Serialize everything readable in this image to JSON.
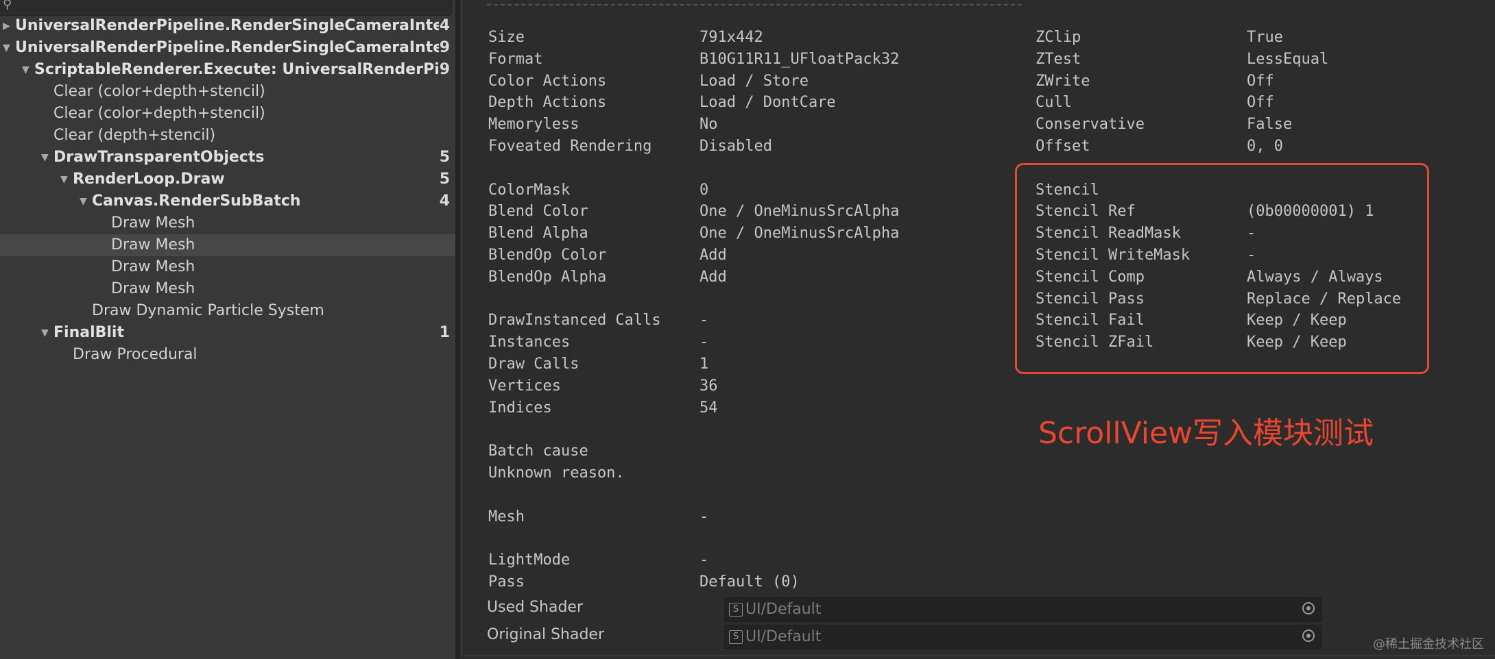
{
  "hierarchy": {
    "rows": [
      {
        "label": "UniversalRenderPipeline.RenderSingleCameraInterna",
        "count": "4",
        "bold": true,
        "arrow": "right",
        "indent": 0
      },
      {
        "label": "UniversalRenderPipeline.RenderSingleCameraInterna",
        "count": "9",
        "bold": true,
        "arrow": "down",
        "indent": 0
      },
      {
        "label": "ScriptableRenderer.Execute: UniversalRenderPipe",
        "count": "9",
        "bold": true,
        "arrow": "down",
        "indent": 1
      },
      {
        "label": "Clear (color+depth+stencil)",
        "count": "",
        "bold": false,
        "arrow": "",
        "indent": 2
      },
      {
        "label": "Clear (color+depth+stencil)",
        "count": "",
        "bold": false,
        "arrow": "",
        "indent": 2
      },
      {
        "label": "Clear (depth+stencil)",
        "count": "",
        "bold": false,
        "arrow": "",
        "indent": 2
      },
      {
        "label": "DrawTransparentObjects",
        "count": "5",
        "bold": true,
        "arrow": "down",
        "indent": 2
      },
      {
        "label": "RenderLoop.Draw",
        "count": "5",
        "bold": true,
        "arrow": "down",
        "indent": 3
      },
      {
        "label": "Canvas.RenderSubBatch",
        "count": "4",
        "bold": true,
        "arrow": "down",
        "indent": 4
      },
      {
        "label": "Draw Mesh",
        "count": "",
        "bold": false,
        "arrow": "",
        "indent": 5
      },
      {
        "label": "Draw Mesh",
        "count": "",
        "bold": false,
        "arrow": "",
        "indent": 5,
        "selected": true
      },
      {
        "label": "Draw Mesh",
        "count": "",
        "bold": false,
        "arrow": "",
        "indent": 5
      },
      {
        "label": "Draw Mesh",
        "count": "",
        "bold": false,
        "arrow": "",
        "indent": 5
      },
      {
        "label": "Draw Dynamic Particle System",
        "count": "",
        "bold": false,
        "arrow": "",
        "indent": 4
      },
      {
        "label": "FinalBlit",
        "count": "1",
        "bold": true,
        "arrow": "down",
        "indent": 2
      },
      {
        "label": "Draw Procedural",
        "count": "",
        "bold": false,
        "arrow": "",
        "indent": 3
      }
    ]
  },
  "details": {
    "left_col": [
      {
        "k": "Size",
        "v": "791x442"
      },
      {
        "k": "Format",
        "v": "B10G11R11_UFloatPack32"
      },
      {
        "k": "Color Actions",
        "v": "Load / Store"
      },
      {
        "k": "Depth Actions",
        "v": "Load / DontCare"
      },
      {
        "k": "Memoryless",
        "v": "No"
      },
      {
        "k": "Foveated Rendering",
        "v": "Disabled"
      },
      {
        "k": "",
        "v": ""
      },
      {
        "k": "ColorMask",
        "v": "0"
      },
      {
        "k": "Blend Color",
        "v": "One / OneMinusSrcAlpha"
      },
      {
        "k": "Blend Alpha",
        "v": "One / OneMinusSrcAlpha"
      },
      {
        "k": "BlendOp Color",
        "v": "Add"
      },
      {
        "k": "BlendOp Alpha",
        "v": "Add"
      },
      {
        "k": "",
        "v": ""
      },
      {
        "k": "DrawInstanced Calls",
        "v": "-"
      },
      {
        "k": "Instances",
        "v": "-"
      },
      {
        "k": "Draw Calls",
        "v": "1"
      },
      {
        "k": "Vertices",
        "v": "36"
      },
      {
        "k": "Indices",
        "v": "54"
      },
      {
        "k": "",
        "v": ""
      },
      {
        "k": "Batch cause",
        "v": ""
      },
      {
        "k": "Unknown reason.",
        "v": ""
      },
      {
        "k": "",
        "v": ""
      },
      {
        "k": "Mesh",
        "v": "-"
      },
      {
        "k": "",
        "v": ""
      },
      {
        "k": "LightMode",
        "v": "-"
      },
      {
        "k": "Pass",
        "v": "Default (0)"
      }
    ],
    "right_col": [
      {
        "k": "ZClip",
        "v": "True"
      },
      {
        "k": "ZTest",
        "v": "LessEqual"
      },
      {
        "k": "ZWrite",
        "v": "Off"
      },
      {
        "k": "Cull",
        "v": "Off"
      },
      {
        "k": "Conservative",
        "v": "False"
      },
      {
        "k": "Offset",
        "v": "0, 0"
      },
      {
        "k": "",
        "v": ""
      },
      {
        "k": "Stencil",
        "v": ""
      },
      {
        "k": "Stencil Ref",
        "v": "(0b00000001) 1"
      },
      {
        "k": "Stencil ReadMask",
        "v": "-"
      },
      {
        "k": "Stencil WriteMask",
        "v": "-"
      },
      {
        "k": "Stencil Comp",
        "v": "Always / Always"
      },
      {
        "k": "Stencil Pass",
        "v": "Replace / Replace"
      },
      {
        "k": "Stencil Fail",
        "v": "Keep / Keep"
      },
      {
        "k": "Stencil ZFail",
        "v": "Keep / Keep"
      }
    ],
    "used_shader_label": "Used Shader",
    "used_shader_value": "UI/Default",
    "original_shader_label": "Original Shader",
    "original_shader_value": "UI/Default",
    "shader_icon_glyph": "S"
  },
  "annotation": "ScrollView写入模块测试",
  "watermark": "@稀土掘金技术社区",
  "colors": {
    "highlight": "#e14a33",
    "annotation": "#ea4630"
  }
}
